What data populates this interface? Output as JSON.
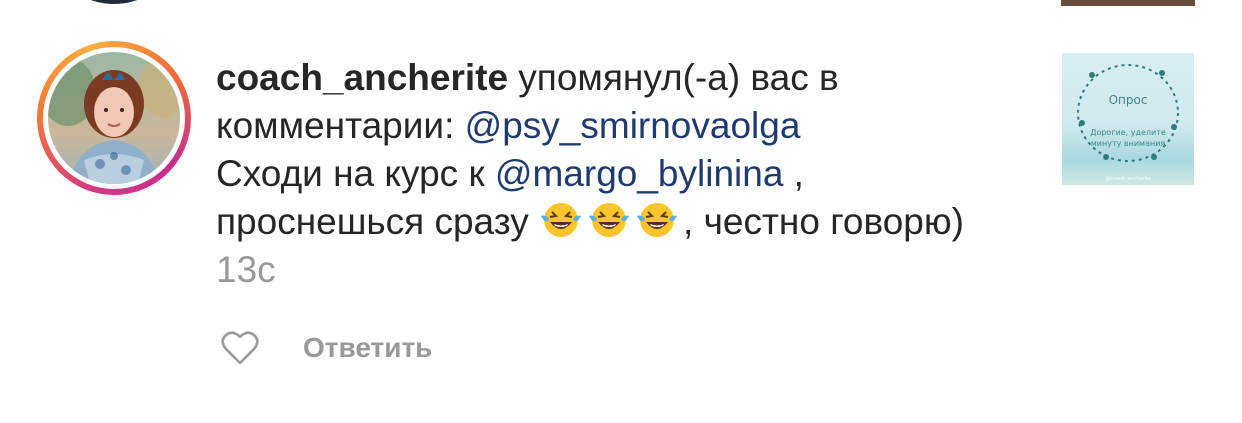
{
  "comment": {
    "username": "coach_ancherite",
    "action_text": " упомянул(-а) вас в комментарии: ",
    "mention1": "@psy_smirnovaolga",
    "text1": "Сходи на курс к ",
    "mention2": "@margo_bylinina",
    "text2": " , проснешься сразу ",
    "emojis": [
      "face-with-tears-of-joy-icon",
      "face-with-tears-of-joy-icon",
      "face-with-tears-of-joy-icon"
    ],
    "text3": ", честно говорю) ",
    "timestamp": "13с"
  },
  "actions": {
    "reply_label": "Ответить"
  },
  "post_thumbnail": {
    "title": "Опрос",
    "subtitle": "Дорогие, уделите минуту внимания",
    "handle": "@coach_ancherite"
  },
  "colors": {
    "mention": "#1e3a6e",
    "text": "#262626",
    "muted": "#999999",
    "ring_start": "#d63a82",
    "ring_end": "#fbae3c"
  }
}
